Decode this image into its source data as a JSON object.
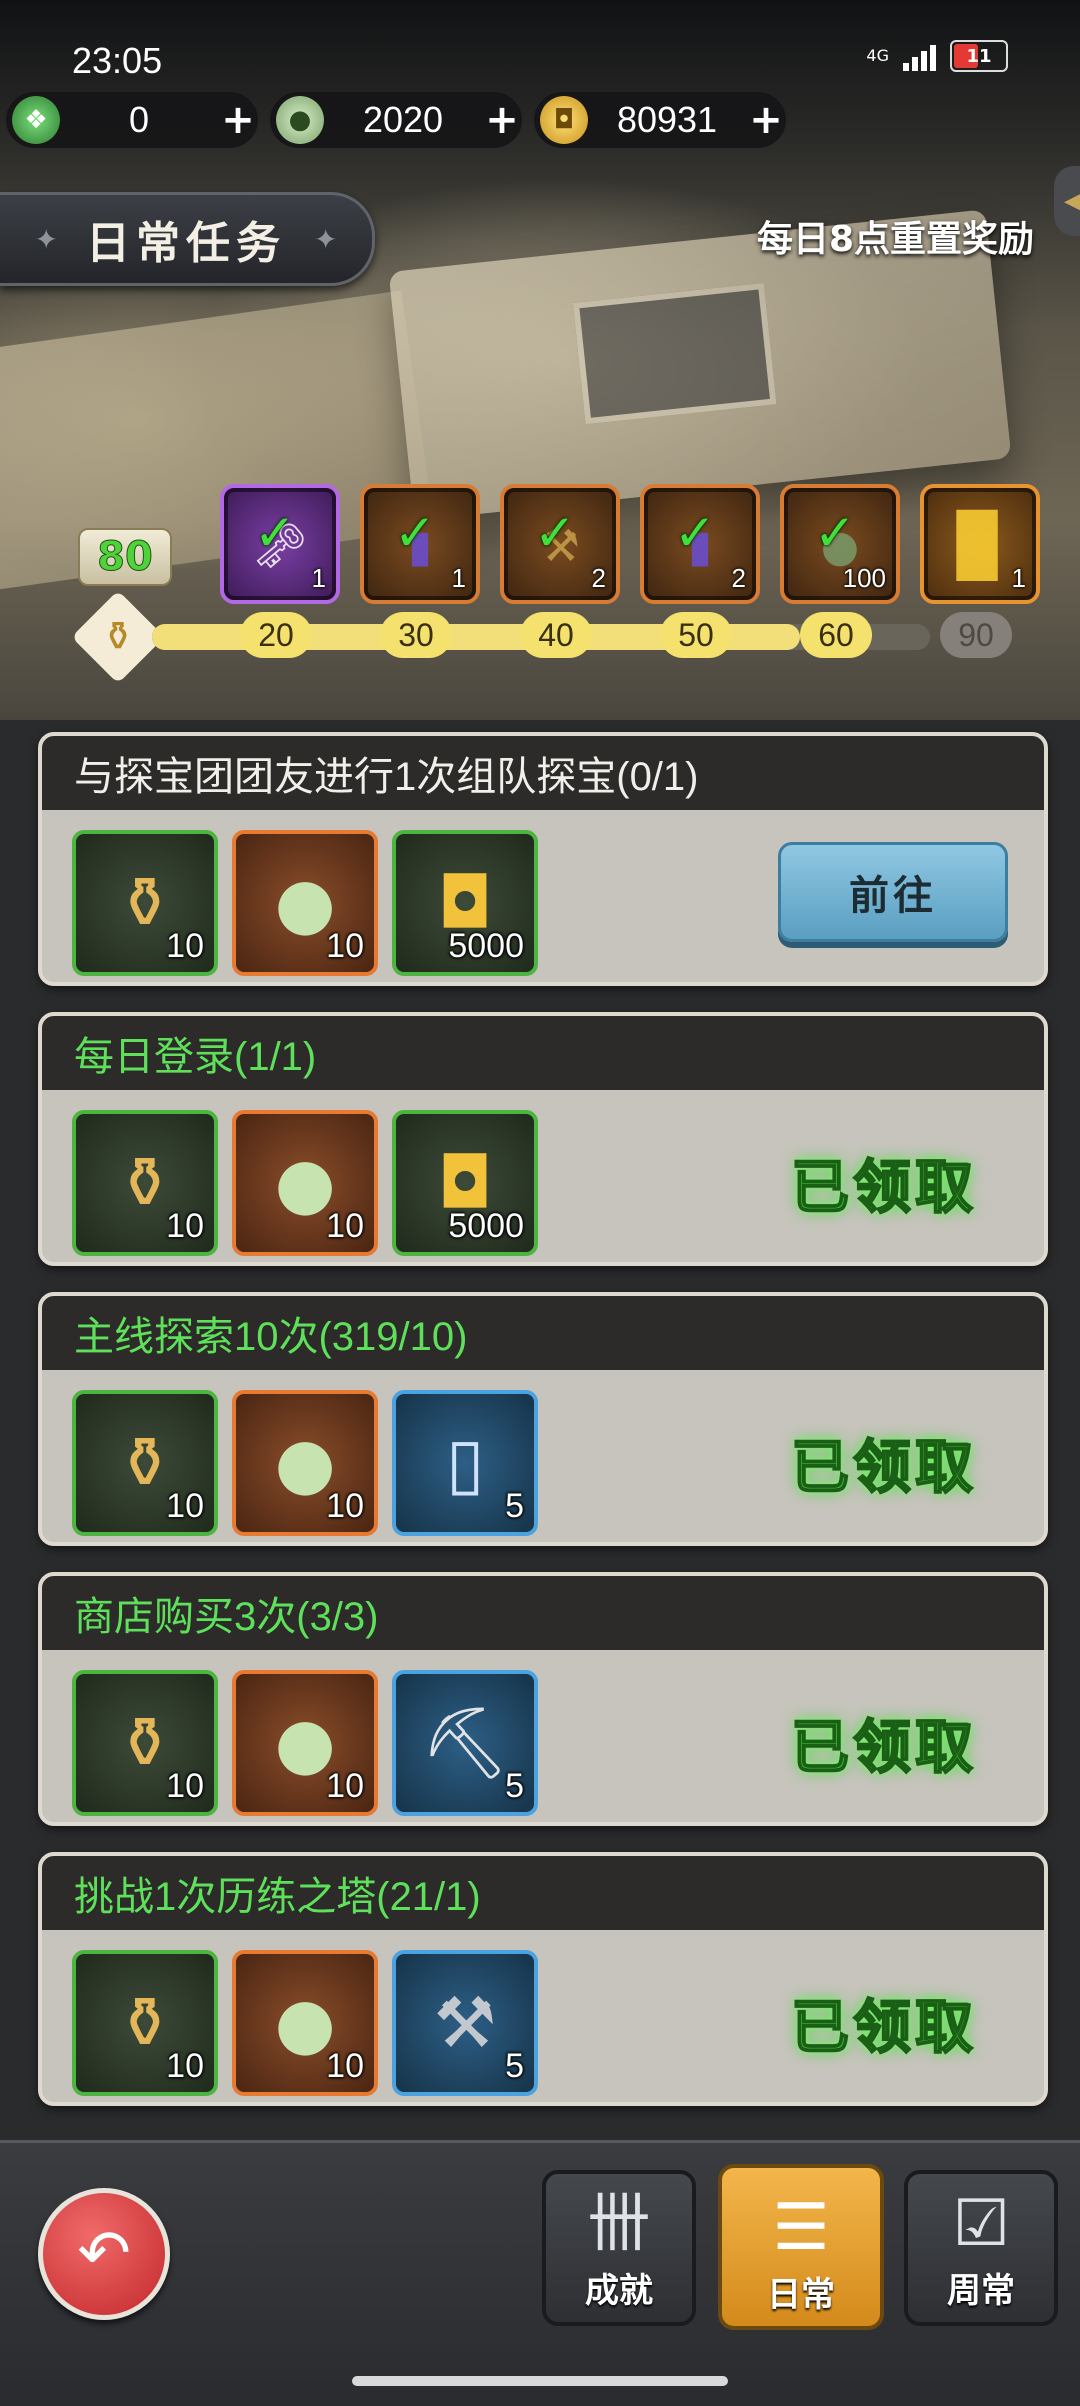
{
  "status_bar": {
    "time": "23:05",
    "network": "4G",
    "battery": "11"
  },
  "currencies": [
    {
      "name": "jade",
      "value": "0",
      "icon": "jade-icon"
    },
    {
      "name": "pouch",
      "value": "2020",
      "icon": "pouch-icon"
    },
    {
      "name": "coin",
      "value": "80931",
      "icon": "coin-icon"
    }
  ],
  "header": {
    "title": "日常任务",
    "reset_note": "每日8点重置奖励"
  },
  "progress": {
    "points": "80",
    "fraction": 0.833,
    "milestones": [
      "20",
      "30",
      "40",
      "50",
      "60",
      "90"
    ],
    "chests": [
      {
        "count": "1",
        "claimed": true
      },
      {
        "count": "1",
        "claimed": true
      },
      {
        "count": "2",
        "claimed": true
      },
      {
        "count": "2",
        "claimed": true
      },
      {
        "count": "100",
        "claimed": true
      },
      {
        "count": "1",
        "claimed": false
      }
    ]
  },
  "tasks": [
    {
      "title": "与探宝团团友进行1次组队探宝(0/1)",
      "status": "前往",
      "rewards": [
        "10",
        "10",
        "5000"
      ]
    },
    {
      "title": "每日登录(1/1)",
      "status": "已领取",
      "rewards": [
        "10",
        "10",
        "5000"
      ]
    },
    {
      "title": "主线探索10次(319/10)",
      "status": "已领取",
      "rewards": [
        "10",
        "10",
        "5"
      ]
    },
    {
      "title": "商店购买3次(3/3)",
      "status": "已领取",
      "rewards": [
        "10",
        "10",
        "5"
      ]
    },
    {
      "title": "挑战1次历练之塔(21/1)",
      "status": "已领取",
      "rewards": [
        "10",
        "10",
        "5"
      ]
    }
  ],
  "bottom_nav": {
    "achievements": "成就",
    "daily": "日常",
    "weekly": "周常"
  },
  "colors": {
    "accent_green": "#3bcf32",
    "go_button": "#8fc8e2",
    "active_tab": "#f3b64b"
  }
}
